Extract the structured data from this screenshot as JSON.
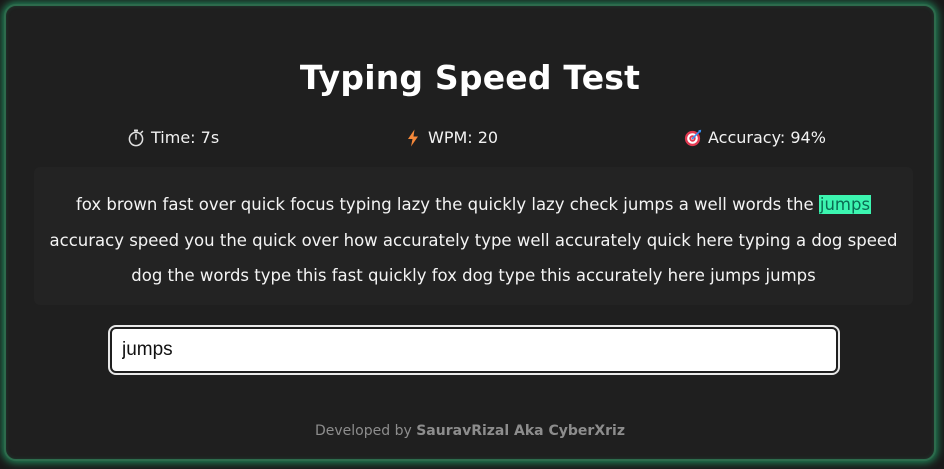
{
  "title": "Typing Speed Test",
  "stats": {
    "time": {
      "icon": "stopwatch-icon",
      "label": "Time: 7s"
    },
    "wpm": {
      "icon": "lightning-icon",
      "label": "WPM: 20"
    },
    "accuracy": {
      "icon": "target-icon",
      "label": "Accuracy: 94%"
    }
  },
  "passage": {
    "before": "fox brown fast over quick focus typing lazy the quickly lazy check jumps a well words the",
    "current": "jumps",
    "after": "accuracy speed you the quick over how accurately type well accurately quick here typing a dog speed dog the words type this fast quickly fox dog type this accurately here jumps jumps"
  },
  "input": {
    "value": "jumps"
  },
  "footer": {
    "prefix": "Developed by",
    "author": "SauravRizal Aka CyberXriz"
  },
  "colors": {
    "accent": "#3cf5b0",
    "glow": "#28dc8c",
    "background": "#1f1f1f"
  }
}
